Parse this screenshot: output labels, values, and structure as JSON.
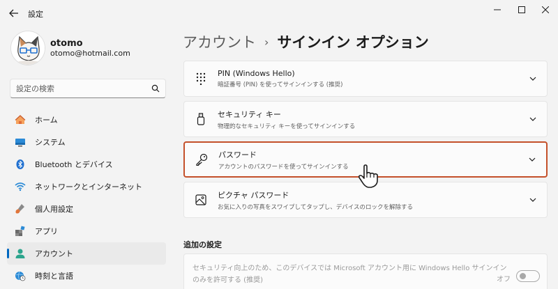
{
  "window": {
    "title": "設定",
    "controls": [
      "minimize",
      "maximize",
      "close"
    ]
  },
  "user": {
    "name": "otomo",
    "email": "otomo@hotmail.com"
  },
  "search": {
    "placeholder": "設定の検索",
    "icon": "search-icon"
  },
  "sidebar": {
    "items": [
      {
        "label": "ホーム",
        "icon": "home-icon",
        "active": false
      },
      {
        "label": "システム",
        "icon": "system-icon",
        "active": false
      },
      {
        "label": "Bluetooth とデバイス",
        "icon": "bluetooth-icon",
        "active": false
      },
      {
        "label": "ネットワークとインターネット",
        "icon": "wifi-icon",
        "active": false
      },
      {
        "label": "個人用設定",
        "icon": "brush-icon",
        "active": false
      },
      {
        "label": "アプリ",
        "icon": "apps-icon",
        "active": false
      },
      {
        "label": "アカウント",
        "icon": "account-icon",
        "active": true
      },
      {
        "label": "時刻と言語",
        "icon": "globe-clock-icon",
        "active": false
      }
    ]
  },
  "breadcrumb": {
    "parent": "アカウント",
    "separator": "›",
    "current": "サインイン オプション"
  },
  "options": [
    {
      "title": "PIN (Windows Hello)",
      "subtitle": "暗証番号 (PIN) を使ってサインインする (推奨)",
      "icon": "keypad-icon"
    },
    {
      "title": "セキュリティ キー",
      "subtitle": "物理的なセキュリティ キーを使ってサインインする",
      "icon": "usb-key-icon"
    },
    {
      "title": "パスワード",
      "subtitle": "アカウントのパスワードを使ってサインインする",
      "icon": "key-icon",
      "highlighted": true
    },
    {
      "title": "ピクチャ パスワード",
      "subtitle": "お気に入りの写真をスワイプしてタップし、デバイスのロックを解除する",
      "icon": "picture-icon"
    }
  ],
  "additional": {
    "title": "追加の設定",
    "description": "セキュリティ向上のため、このデバイスでは Microsoft アカウント用に Windows Hello サインインのみを許可する (推奨)",
    "toggle_label": "オフ",
    "toggle_on": false
  },
  "colors": {
    "accent": "#0067c0",
    "highlight_border": "#c4502a"
  }
}
